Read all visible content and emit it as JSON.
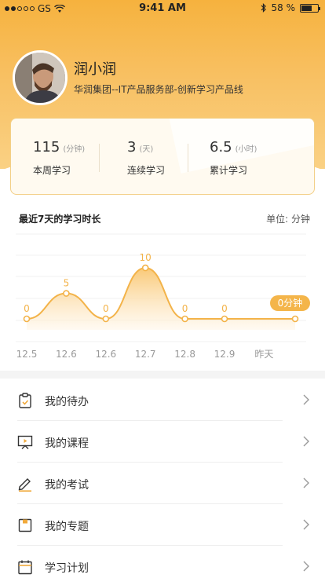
{
  "status_bar": {
    "carrier": "GS",
    "time": "9:41 AM",
    "battery": "58 %",
    "battery_level": 0.58
  },
  "profile": {
    "name": "润小润",
    "org": "华润集团--IT产品服务部-创新学习产品线"
  },
  "stats": [
    {
      "value": "115",
      "unit": "(分钟)",
      "label": "本周学习"
    },
    {
      "value": "3",
      "unit": "(天)",
      "label": "连续学习"
    },
    {
      "value": "6.5",
      "unit": "(小时)",
      "label": "累计学习"
    }
  ],
  "chart_header": {
    "title": "最近7天的学习时长",
    "unit_label": "单位: 分钟"
  },
  "chart_data": {
    "type": "area",
    "title": "最近7天的学习时长",
    "ylabel": "单位: 分钟",
    "categories": [
      "12.5",
      "12.6",
      "12.6",
      "12.7",
      "12.8",
      "12.9",
      "昨天"
    ],
    "values": [
      0,
      5,
      0,
      10,
      0,
      0,
      0
    ],
    "point_labels": [
      "0",
      "5",
      "0",
      "10",
      "0",
      "0"
    ],
    "current_label": "0分钟",
    "ylim": [
      0,
      12
    ],
    "grid": true,
    "colors": {
      "line": "#f3b349",
      "fill_top": "#f9c977",
      "fill_bottom": "#fff6e8",
      "badge": "#f4b54a"
    }
  },
  "menu": [
    {
      "label": "我的待办",
      "icon": "clipboard-icon"
    },
    {
      "label": "我的课程",
      "icon": "presentation-icon"
    },
    {
      "label": "我的考试",
      "icon": "pencil-icon"
    },
    {
      "label": "我的专题",
      "icon": "topic-icon"
    },
    {
      "label": "学习计划",
      "icon": "calendar-icon"
    }
  ]
}
